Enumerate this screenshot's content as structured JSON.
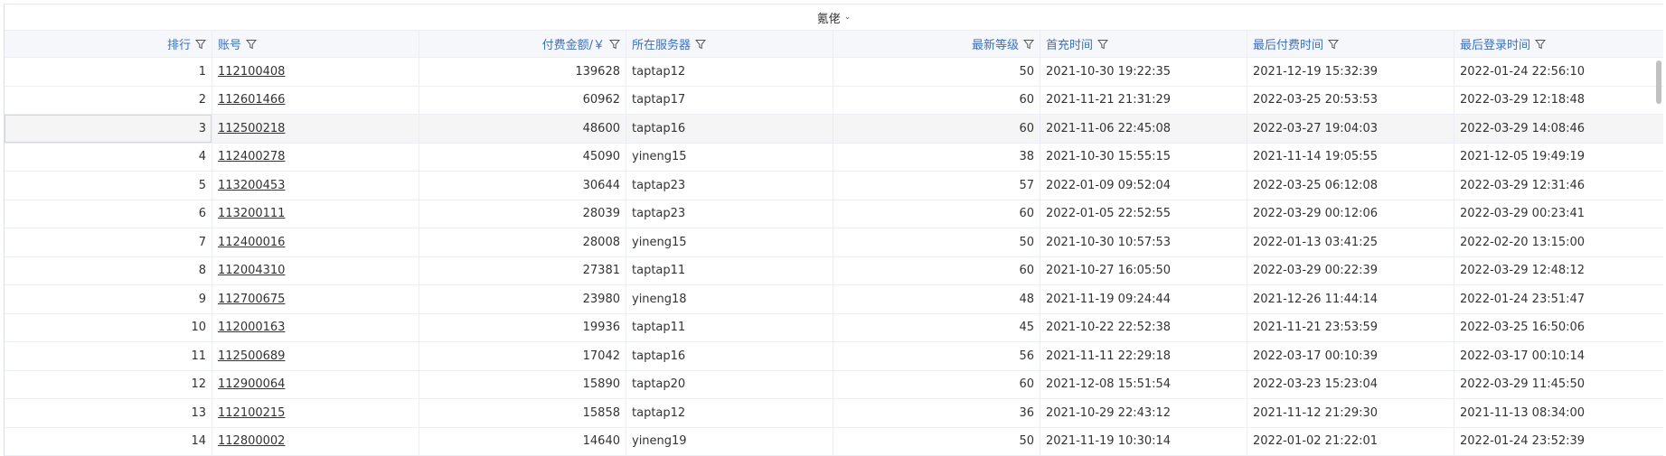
{
  "group_header": {
    "label": "氪佬"
  },
  "columns": [
    {
      "label": "排行"
    },
    {
      "label": "账号"
    },
    {
      "label": "付费金额/￥"
    },
    {
      "label": "所在服务器"
    },
    {
      "label": "最新等级"
    },
    {
      "label": "首充时间"
    },
    {
      "label": "最后付费时间"
    },
    {
      "label": "最后登录时间"
    }
  ],
  "rows": [
    {
      "rank": "1",
      "account": "112100408",
      "amount": "139628",
      "server": "taptap12",
      "level": "50",
      "first_pay": "2021-10-30 19:22:35",
      "last_pay": "2021-12-19 15:32:39",
      "last_login": "2022-01-24 22:56:10"
    },
    {
      "rank": "2",
      "account": "112601466",
      "amount": "60962",
      "server": "taptap17",
      "level": "60",
      "first_pay": "2021-11-21 21:31:29",
      "last_pay": "2022-03-25 20:53:53",
      "last_login": "2022-03-29 12:18:48"
    },
    {
      "rank": "3",
      "account": "112500218",
      "amount": "48600",
      "server": "taptap16",
      "level": "60",
      "first_pay": "2021-11-06 22:45:08",
      "last_pay": "2022-03-27 19:04:03",
      "last_login": "2022-03-29 14:08:46"
    },
    {
      "rank": "4",
      "account": "112400278",
      "amount": "45090",
      "server": "yineng15",
      "level": "38",
      "first_pay": "2021-10-30 15:55:15",
      "last_pay": "2021-11-14 19:05:55",
      "last_login": "2021-12-05 19:49:19"
    },
    {
      "rank": "5",
      "account": "113200453",
      "amount": "30644",
      "server": "taptap23",
      "level": "57",
      "first_pay": "2022-01-09 09:52:04",
      "last_pay": "2022-03-25 06:12:08",
      "last_login": "2022-03-29 12:31:46"
    },
    {
      "rank": "6",
      "account": "113200111",
      "amount": "28039",
      "server": "taptap23",
      "level": "60",
      "first_pay": "2022-01-05 22:52:55",
      "last_pay": "2022-03-29 00:12:06",
      "last_login": "2022-03-29 00:23:41"
    },
    {
      "rank": "7",
      "account": "112400016",
      "amount": "28008",
      "server": "yineng15",
      "level": "50",
      "first_pay": "2021-10-30 10:57:53",
      "last_pay": "2022-01-13 03:41:25",
      "last_login": "2022-02-20 13:15:00"
    },
    {
      "rank": "8",
      "account": "112004310",
      "amount": "27381",
      "server": "taptap11",
      "level": "60",
      "first_pay": "2021-10-27 16:05:50",
      "last_pay": "2022-03-29 00:22:39",
      "last_login": "2022-03-29 12:48:12"
    },
    {
      "rank": "9",
      "account": "112700675",
      "amount": "23980",
      "server": "yineng18",
      "level": "48",
      "first_pay": "2021-11-19 09:24:44",
      "last_pay": "2021-12-26 11:44:14",
      "last_login": "2022-01-24 23:51:47"
    },
    {
      "rank": "10",
      "account": "112000163",
      "amount": "19936",
      "server": "taptap11",
      "level": "45",
      "first_pay": "2021-10-22 22:52:38",
      "last_pay": "2021-11-21 23:53:59",
      "last_login": "2022-03-25 16:50:06"
    },
    {
      "rank": "11",
      "account": "112500689",
      "amount": "17042",
      "server": "taptap16",
      "level": "56",
      "first_pay": "2021-11-11 22:29:18",
      "last_pay": "2022-03-17 00:10:39",
      "last_login": "2022-03-17 00:10:14"
    },
    {
      "rank": "12",
      "account": "112900064",
      "amount": "15890",
      "server": "taptap20",
      "level": "60",
      "first_pay": "2021-12-08 15:51:54",
      "last_pay": "2022-03-23 15:23:04",
      "last_login": "2022-03-29 11:45:50"
    },
    {
      "rank": "13",
      "account": "112100215",
      "amount": "15858",
      "server": "taptap12",
      "level": "36",
      "first_pay": "2021-10-29 22:43:12",
      "last_pay": "2021-11-12 21:29:30",
      "last_login": "2021-11-13 08:34:00"
    },
    {
      "rank": "14",
      "account": "112800002",
      "amount": "14640",
      "server": "yineng19",
      "level": "50",
      "first_pay": "2021-11-19 10:30:14",
      "last_pay": "2022-01-02 21:22:01",
      "last_login": "2022-01-24 23:52:39"
    }
  ],
  "highlighted_row": "3",
  "icons": {
    "filter": "filter-icon",
    "dropdown": "chevron-down-icon"
  }
}
